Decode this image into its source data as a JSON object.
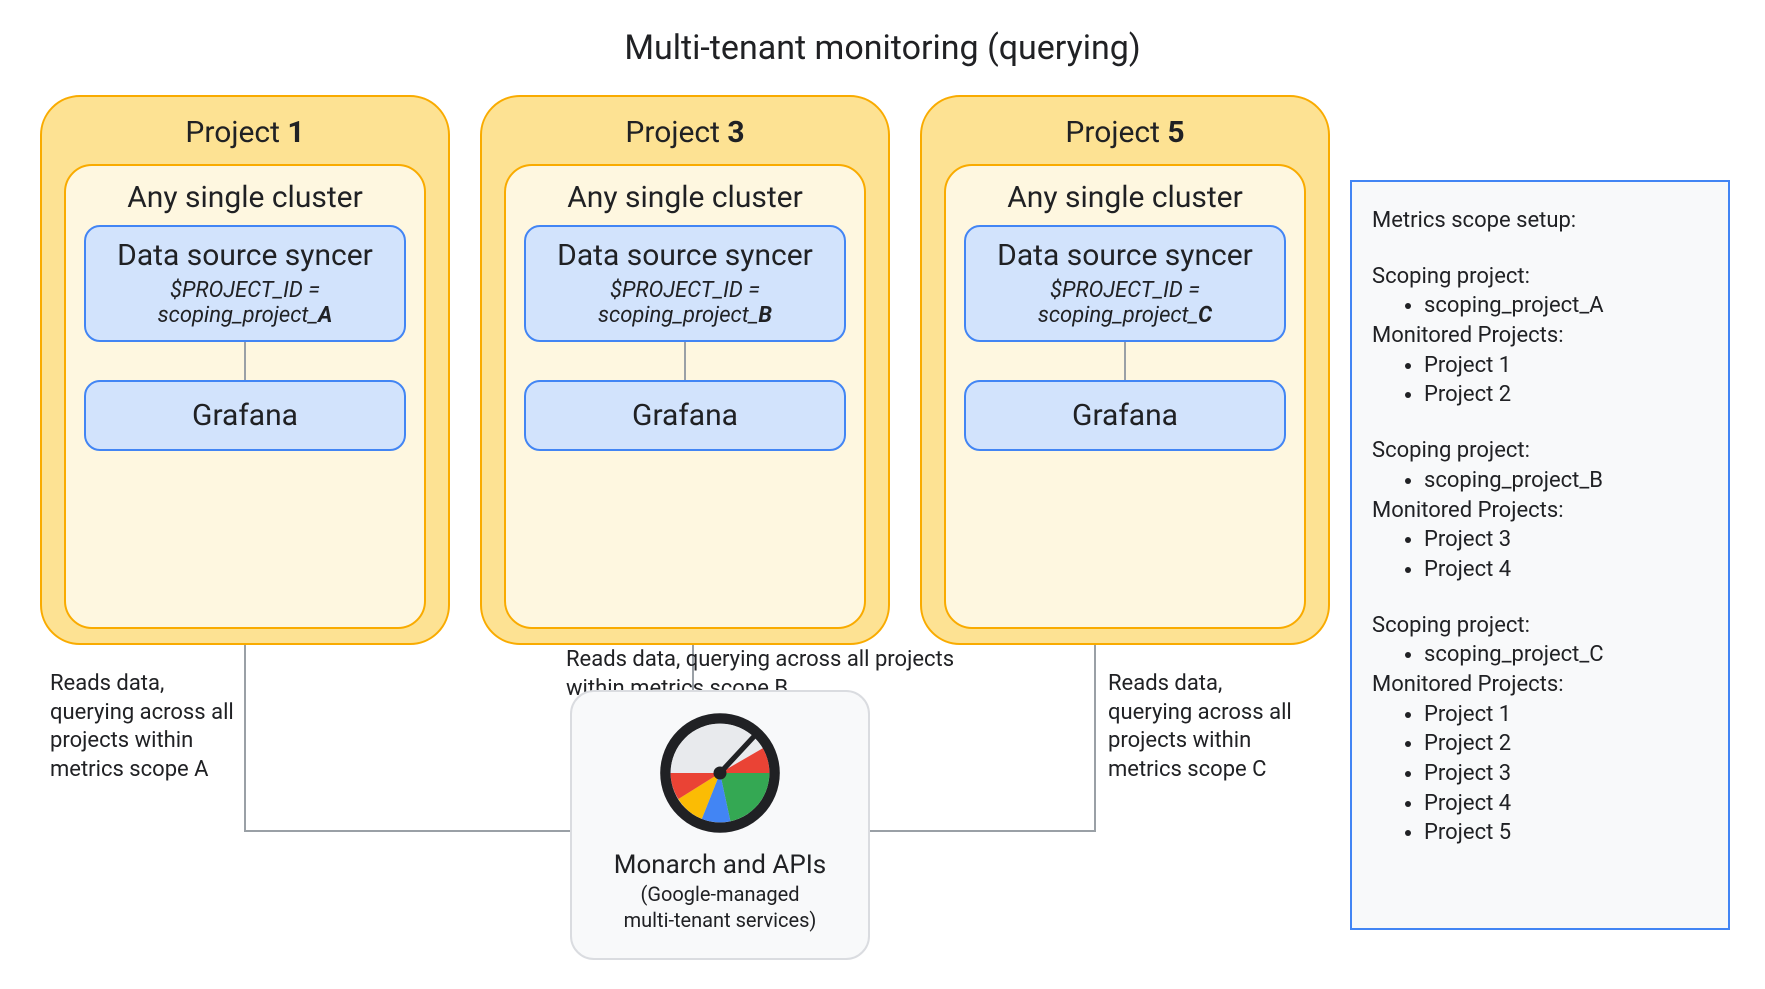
{
  "title": "Multi-tenant monitoring (querying)",
  "projects": [
    {
      "name_prefix": "Project ",
      "name_num": "1",
      "cluster_label": "Any single cluster",
      "ds_title": "Data source syncer",
      "ds_pid_label": "$PROJECT_ID =",
      "ds_scoping_prefix": "scoping_project_",
      "ds_scoping_suffix": "A",
      "grafana_label": "Grafana",
      "read_label": "Reads data, querying across all projects within metrics scope A"
    },
    {
      "name_prefix": "Project ",
      "name_num": "3",
      "cluster_label": "Any single cluster",
      "ds_title": "Data source syncer",
      "ds_pid_label": "$PROJECT_ID =",
      "ds_scoping_prefix": "scoping_project_",
      "ds_scoping_suffix": "B",
      "grafana_label": "Grafana",
      "read_label": "Reads data, querying across all projects within metrics scope B"
    },
    {
      "name_prefix": "Project ",
      "name_num": "5",
      "cluster_label": "Any single cluster",
      "ds_title": "Data source syncer",
      "ds_pid_label": "$PROJECT_ID =",
      "ds_scoping_prefix": "scoping_project_",
      "ds_scoping_suffix": "C",
      "grafana_label": "Grafana",
      "read_label": "Reads data, querying across all projects within metrics scope C"
    }
  ],
  "monarch": {
    "title": "Monarch and APIs",
    "sub1": "(Google-managed",
    "sub2": "multi-tenant services)"
  },
  "side": {
    "heading": "Metrics scope setup:",
    "scopes": [
      {
        "scoping_hdr": "Scoping project:",
        "scoping_val": "scoping_project_A",
        "monitored_hdr": "Monitored Projects:",
        "monitored": [
          "Project 1",
          "Project 2"
        ]
      },
      {
        "scoping_hdr": "Scoping project:",
        "scoping_val": "scoping_project_B",
        "monitored_hdr": "Monitored Projects:",
        "monitored": [
          "Project 3",
          "Project 4"
        ]
      },
      {
        "scoping_hdr": "Scoping project:",
        "scoping_val": "scoping_project_C",
        "monitored_hdr": "Monitored Projects:",
        "monitored": [
          "Project 1",
          "Project 2",
          "Project 3",
          "Project 4",
          "Project 5"
        ]
      }
    ]
  }
}
